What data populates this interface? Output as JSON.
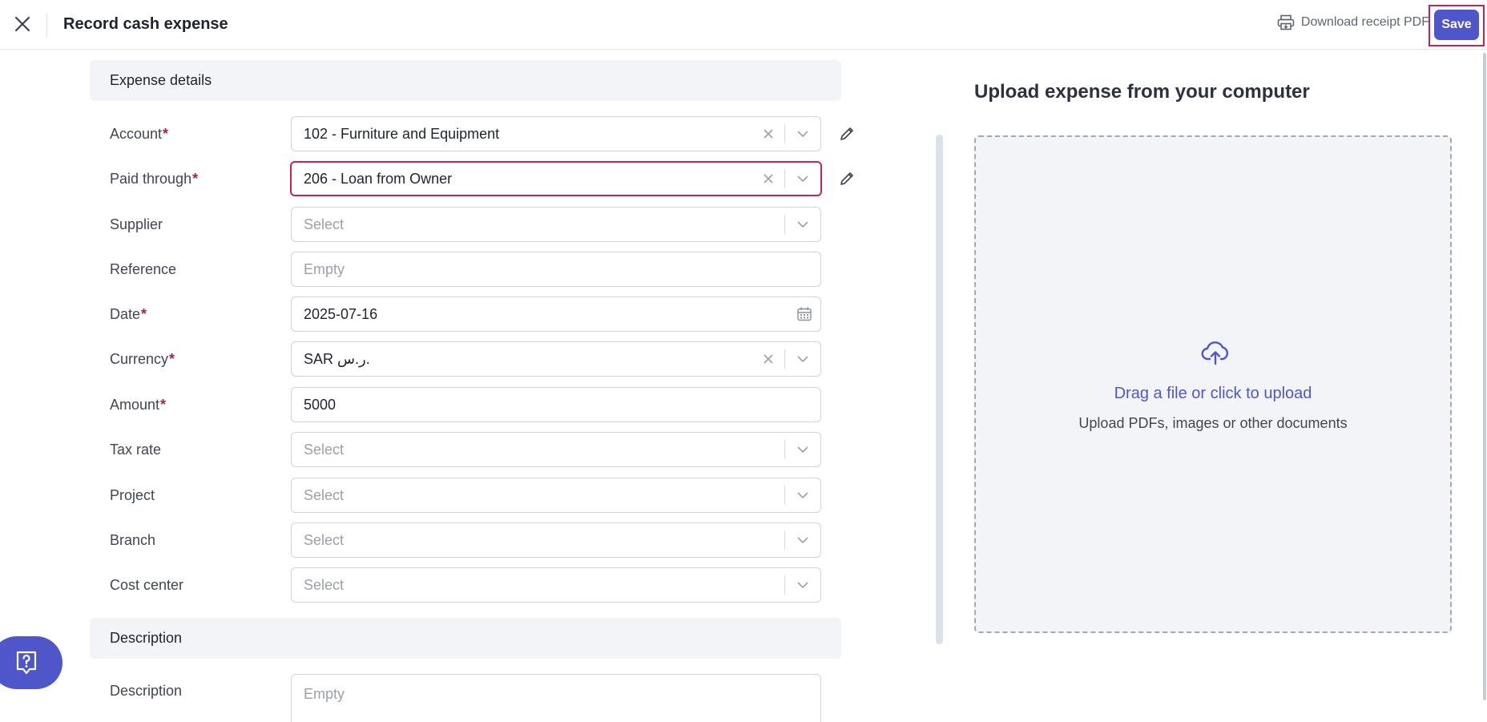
{
  "header": {
    "title": "Record cash expense",
    "download_label": "Download receipt PDF",
    "save_label": "Save"
  },
  "sections": {
    "expense_details": "Expense details",
    "description": "Description"
  },
  "form": {
    "account": {
      "label": "Account",
      "value": "102 - Furniture and Equipment"
    },
    "paid_through": {
      "label": "Paid through",
      "value": "206 - Loan from Owner"
    },
    "supplier": {
      "label": "Supplier",
      "placeholder": "Select"
    },
    "reference": {
      "label": "Reference",
      "placeholder": "Empty"
    },
    "date": {
      "label": "Date",
      "value": "2025-07-16"
    },
    "currency": {
      "label": "Currency",
      "value": "SAR ر.س."
    },
    "amount": {
      "label": "Amount",
      "value": "5000"
    },
    "tax_rate": {
      "label": "Tax rate",
      "placeholder": "Select"
    },
    "project": {
      "label": "Project",
      "placeholder": "Select"
    },
    "branch": {
      "label": "Branch",
      "placeholder": "Select"
    },
    "cost_center": {
      "label": "Cost center",
      "placeholder": "Select"
    },
    "description": {
      "label": "Description",
      "placeholder": "Empty"
    },
    "required_mark": "*"
  },
  "upload": {
    "title": "Upload expense from your computer",
    "main_text": "Drag a file or click to upload",
    "sub_text": "Upload PDFs, images or other documents"
  },
  "colors": {
    "primary": "#4f56c9",
    "required": "#a8204b",
    "highlight": "#c8234f"
  },
  "icons": {
    "close": "close-icon",
    "print": "print-icon",
    "pencil": "pencil-icon",
    "chevron": "chevron-down-icon",
    "clear": "clear-icon",
    "calendar": "calendar-icon",
    "upload": "cloud-upload-icon",
    "help": "help-icon"
  }
}
